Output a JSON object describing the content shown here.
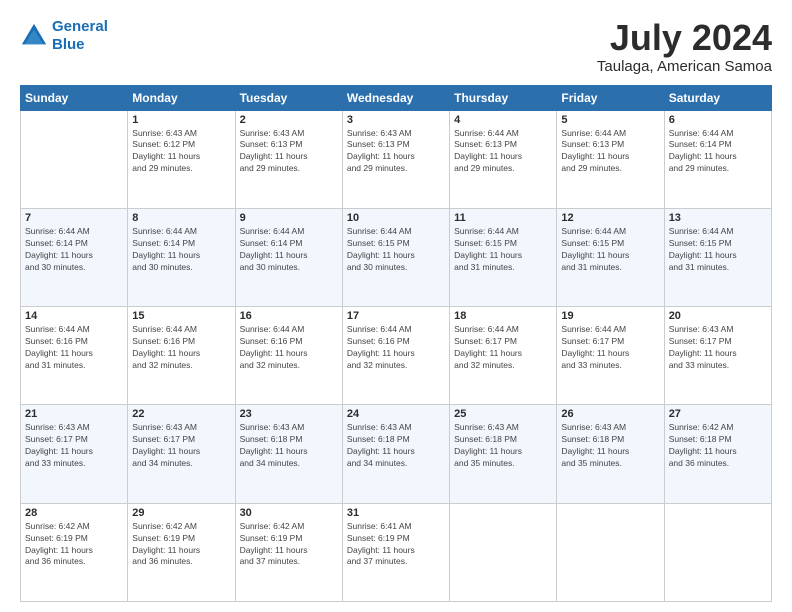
{
  "logo": {
    "line1": "General",
    "line2": "Blue"
  },
  "header": {
    "title": "July 2024",
    "subtitle": "Taulaga, American Samoa"
  },
  "weekdays": [
    "Sunday",
    "Monday",
    "Tuesday",
    "Wednesday",
    "Thursday",
    "Friday",
    "Saturday"
  ],
  "weeks": [
    [
      {
        "day": "",
        "info": ""
      },
      {
        "day": "1",
        "info": "Sunrise: 6:43 AM\nSunset: 6:12 PM\nDaylight: 11 hours\nand 29 minutes."
      },
      {
        "day": "2",
        "info": "Sunrise: 6:43 AM\nSunset: 6:13 PM\nDaylight: 11 hours\nand 29 minutes."
      },
      {
        "day": "3",
        "info": "Sunrise: 6:43 AM\nSunset: 6:13 PM\nDaylight: 11 hours\nand 29 minutes."
      },
      {
        "day": "4",
        "info": "Sunrise: 6:44 AM\nSunset: 6:13 PM\nDaylight: 11 hours\nand 29 minutes."
      },
      {
        "day": "5",
        "info": "Sunrise: 6:44 AM\nSunset: 6:13 PM\nDaylight: 11 hours\nand 29 minutes."
      },
      {
        "day": "6",
        "info": "Sunrise: 6:44 AM\nSunset: 6:14 PM\nDaylight: 11 hours\nand 29 minutes."
      }
    ],
    [
      {
        "day": "7",
        "info": "Sunrise: 6:44 AM\nSunset: 6:14 PM\nDaylight: 11 hours\nand 30 minutes."
      },
      {
        "day": "8",
        "info": "Sunrise: 6:44 AM\nSunset: 6:14 PM\nDaylight: 11 hours\nand 30 minutes."
      },
      {
        "day": "9",
        "info": "Sunrise: 6:44 AM\nSunset: 6:14 PM\nDaylight: 11 hours\nand 30 minutes."
      },
      {
        "day": "10",
        "info": "Sunrise: 6:44 AM\nSunset: 6:15 PM\nDaylight: 11 hours\nand 30 minutes."
      },
      {
        "day": "11",
        "info": "Sunrise: 6:44 AM\nSunset: 6:15 PM\nDaylight: 11 hours\nand 31 minutes."
      },
      {
        "day": "12",
        "info": "Sunrise: 6:44 AM\nSunset: 6:15 PM\nDaylight: 11 hours\nand 31 minutes."
      },
      {
        "day": "13",
        "info": "Sunrise: 6:44 AM\nSunset: 6:15 PM\nDaylight: 11 hours\nand 31 minutes."
      }
    ],
    [
      {
        "day": "14",
        "info": "Sunrise: 6:44 AM\nSunset: 6:16 PM\nDaylight: 11 hours\nand 31 minutes."
      },
      {
        "day": "15",
        "info": "Sunrise: 6:44 AM\nSunset: 6:16 PM\nDaylight: 11 hours\nand 32 minutes."
      },
      {
        "day": "16",
        "info": "Sunrise: 6:44 AM\nSunset: 6:16 PM\nDaylight: 11 hours\nand 32 minutes."
      },
      {
        "day": "17",
        "info": "Sunrise: 6:44 AM\nSunset: 6:16 PM\nDaylight: 11 hours\nand 32 minutes."
      },
      {
        "day": "18",
        "info": "Sunrise: 6:44 AM\nSunset: 6:17 PM\nDaylight: 11 hours\nand 32 minutes."
      },
      {
        "day": "19",
        "info": "Sunrise: 6:44 AM\nSunset: 6:17 PM\nDaylight: 11 hours\nand 33 minutes."
      },
      {
        "day": "20",
        "info": "Sunrise: 6:43 AM\nSunset: 6:17 PM\nDaylight: 11 hours\nand 33 minutes."
      }
    ],
    [
      {
        "day": "21",
        "info": "Sunrise: 6:43 AM\nSunset: 6:17 PM\nDaylight: 11 hours\nand 33 minutes."
      },
      {
        "day": "22",
        "info": "Sunrise: 6:43 AM\nSunset: 6:17 PM\nDaylight: 11 hours\nand 34 minutes."
      },
      {
        "day": "23",
        "info": "Sunrise: 6:43 AM\nSunset: 6:18 PM\nDaylight: 11 hours\nand 34 minutes."
      },
      {
        "day": "24",
        "info": "Sunrise: 6:43 AM\nSunset: 6:18 PM\nDaylight: 11 hours\nand 34 minutes."
      },
      {
        "day": "25",
        "info": "Sunrise: 6:43 AM\nSunset: 6:18 PM\nDaylight: 11 hours\nand 35 minutes."
      },
      {
        "day": "26",
        "info": "Sunrise: 6:43 AM\nSunset: 6:18 PM\nDaylight: 11 hours\nand 35 minutes."
      },
      {
        "day": "27",
        "info": "Sunrise: 6:42 AM\nSunset: 6:18 PM\nDaylight: 11 hours\nand 36 minutes."
      }
    ],
    [
      {
        "day": "28",
        "info": "Sunrise: 6:42 AM\nSunset: 6:19 PM\nDaylight: 11 hours\nand 36 minutes."
      },
      {
        "day": "29",
        "info": "Sunrise: 6:42 AM\nSunset: 6:19 PM\nDaylight: 11 hours\nand 36 minutes."
      },
      {
        "day": "30",
        "info": "Sunrise: 6:42 AM\nSunset: 6:19 PM\nDaylight: 11 hours\nand 37 minutes."
      },
      {
        "day": "31",
        "info": "Sunrise: 6:41 AM\nSunset: 6:19 PM\nDaylight: 11 hours\nand 37 minutes."
      },
      {
        "day": "",
        "info": ""
      },
      {
        "day": "",
        "info": ""
      },
      {
        "day": "",
        "info": ""
      }
    ]
  ]
}
